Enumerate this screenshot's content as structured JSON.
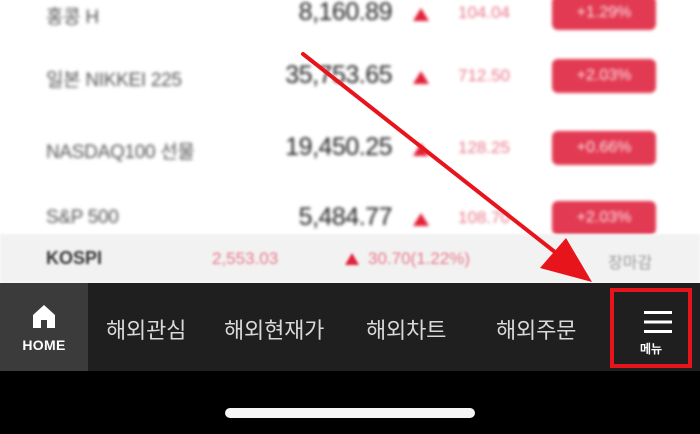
{
  "tickers": [
    {
      "name": "홍콩 H",
      "price": "8,160.89",
      "change": "104.04",
      "pct": "+1.29%"
    },
    {
      "name": "일본 NIKKEI 225",
      "price": "35,753.65",
      "change": "712.50",
      "pct": "+2.03%"
    },
    {
      "name": "NASDAQ100 선물",
      "price": "19,450.25",
      "change": "128.25",
      "pct": "+0.66%"
    },
    {
      "name": "S&P 500",
      "price": "5,484.77",
      "change": "108.70",
      "pct": "+2.03%"
    }
  ],
  "kospi": {
    "name": "KOSPI",
    "value": "2,553.03",
    "change": "30.70(1.22%)",
    "status": "장마감"
  },
  "nav": {
    "home_label": "HOME",
    "items": [
      "해외관심",
      "해외현재가",
      "해외차트",
      "해외주문"
    ],
    "menu_label": "메뉴"
  },
  "colors": {
    "up": "#e2213a",
    "highlight": "#e8141c",
    "nav_bg": "#1f1f1f"
  },
  "icons": {
    "home": "home-icon",
    "menu": "hamburger-menu-icon",
    "up": "triangle-up-icon"
  }
}
